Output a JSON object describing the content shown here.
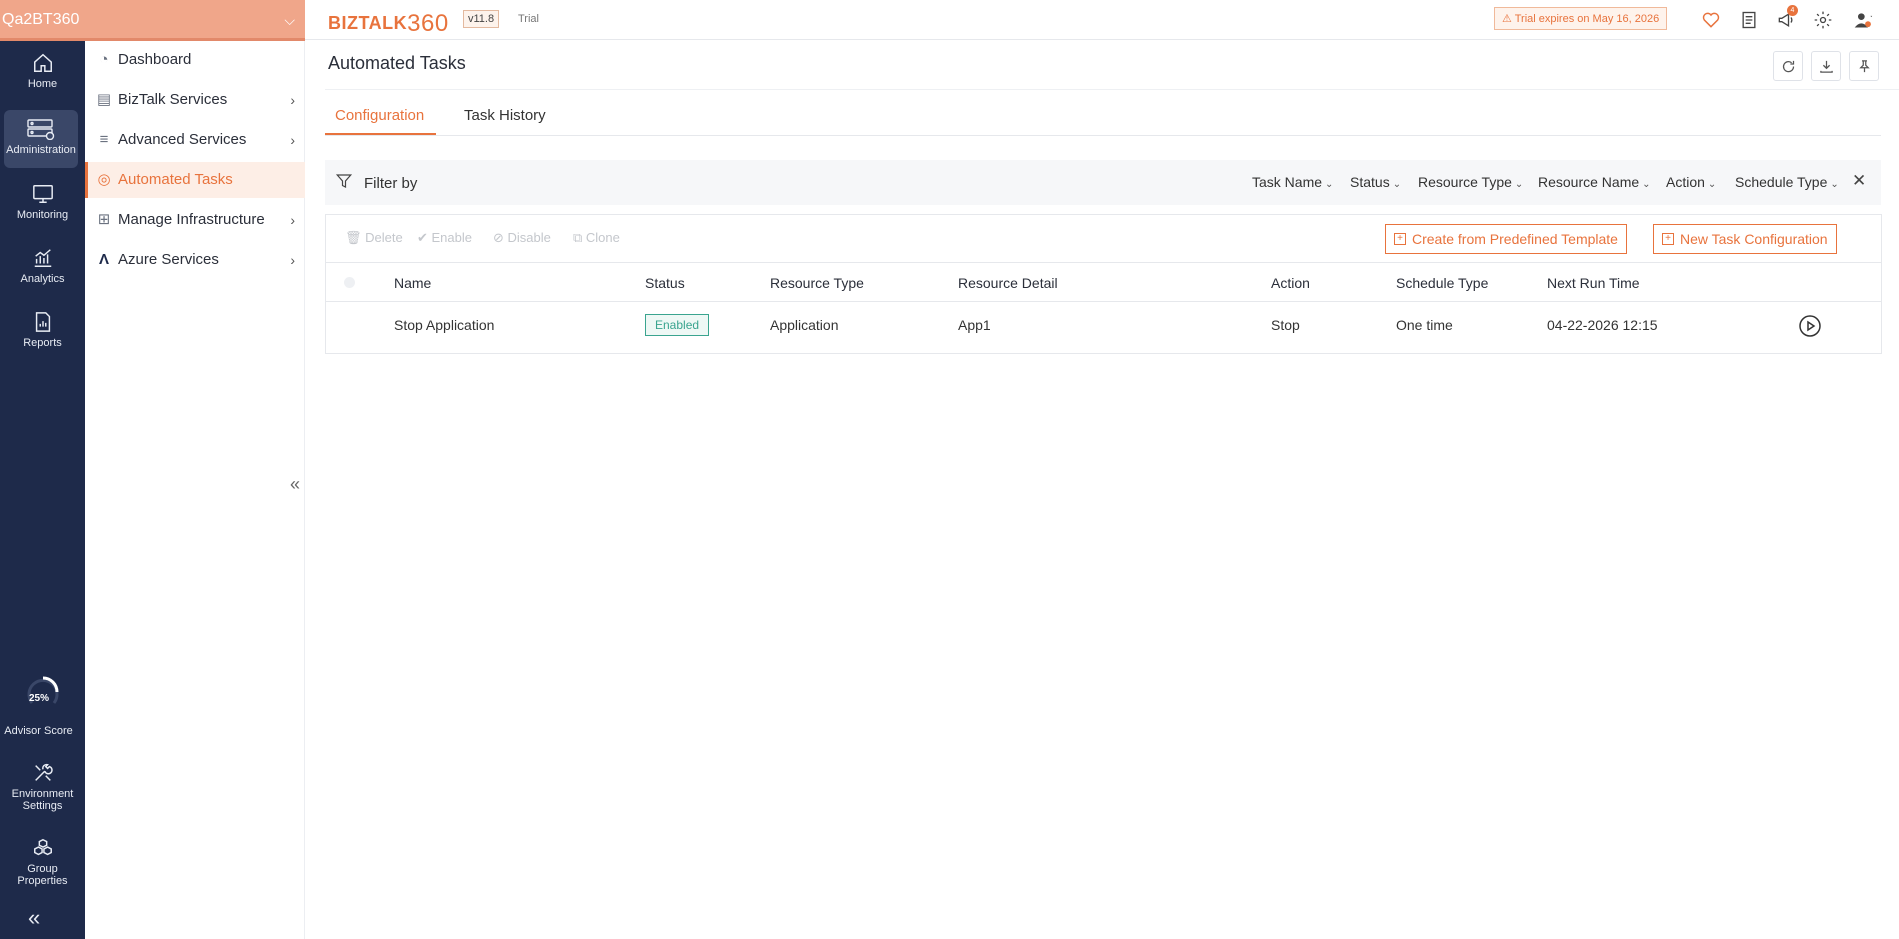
{
  "environment": {
    "name": "Qa2BT360"
  },
  "rail": {
    "items": [
      {
        "label": "Home",
        "icon": "home-icon"
      },
      {
        "label": "Administration",
        "icon": "server-admin-icon"
      },
      {
        "label": "Monitoring",
        "icon": "monitor-icon"
      },
      {
        "label": "Analytics",
        "icon": "analytics-chart-icon"
      },
      {
        "label": "Reports",
        "icon": "report-document-icon"
      }
    ],
    "advisor": {
      "percent": "25%",
      "label": "Advisor Score",
      "fraction": 0.25
    },
    "bottom": [
      {
        "label_line1": "Environment",
        "label_line2": "Settings",
        "icon": "tools-icon"
      },
      {
        "label_line1": "Group",
        "label_line2": "Properties",
        "icon": "group-boxes-icon"
      }
    ],
    "collapse_glyph": "«"
  },
  "subnav": {
    "items": [
      {
        "label": "Dashboard",
        "icon": "pie-chart-icon",
        "has_arrow": false
      },
      {
        "label": "BizTalk Services",
        "icon": "biztalk-icon",
        "has_arrow": true
      },
      {
        "label": "Advanced Services",
        "icon": "layers-icon",
        "has_arrow": true
      },
      {
        "label": "Automated Tasks",
        "icon": "automation-icon",
        "has_arrow": false
      },
      {
        "label": "Manage Infrastructure",
        "icon": "infrastructure-icon",
        "has_arrow": true
      },
      {
        "label": "Azure Services",
        "icon": "azure-icon",
        "has_arrow": true
      }
    ],
    "collapse_glyph": "«",
    "arrow_glyph": "›"
  },
  "header": {
    "logo_text": "BIZTALK",
    "logo_num": "360",
    "version": "v11.8",
    "edition": "Trial",
    "trial_banner": "Trial expires on May 16, 2026",
    "notification_count": "4",
    "accent": "#e8733d"
  },
  "page": {
    "title": "Automated Tasks",
    "tabs": [
      {
        "label": "Configuration"
      },
      {
        "label": "Task History"
      }
    ]
  },
  "filter": {
    "label": "Filter by",
    "dropdowns": [
      "Task Name",
      "Status",
      "Resource Type",
      "Resource Name",
      "Action",
      "Schedule Type"
    ],
    "close_glyph": "✕"
  },
  "toolbar": {
    "delete": "Delete",
    "enable": "Enable",
    "disable": "Disable",
    "clone": "Clone",
    "create_template": "Create from Predefined Template",
    "new_task": "New Task Configuration"
  },
  "table": {
    "columns": [
      "Name",
      "Status",
      "Resource Type",
      "Resource Detail",
      "Action",
      "Schedule Type",
      "Next Run Time"
    ],
    "rows": [
      {
        "name": "Stop Application",
        "status": "Enabled",
        "resource_type": "Application",
        "resource_detail": "App1",
        "action": "Stop",
        "schedule_type": "One time",
        "next_run_time": "04-22-2026 12:15"
      }
    ]
  }
}
